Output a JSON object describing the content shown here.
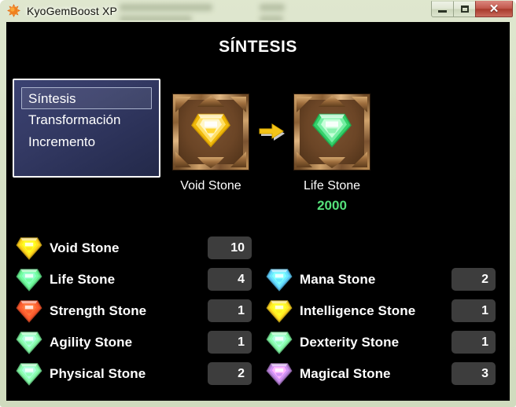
{
  "window": {
    "app_title": "KyoGemBoost XP",
    "app_icon": "sun-icon",
    "controls": {
      "minimize_label": "—",
      "maximize_label": "□",
      "close_label": "✕"
    }
  },
  "page": {
    "title": "SÍNTESIS"
  },
  "mode_list": {
    "selected": "Síntesis",
    "items": [
      {
        "label": "Síntesis",
        "selected": true
      },
      {
        "label": "Transformación",
        "selected": false
      },
      {
        "label": "Incremento",
        "selected": false
      }
    ]
  },
  "preview": {
    "source": {
      "caption": "Void Stone",
      "gem_color": "#f5c518",
      "gem_icon": "void-stone-gem"
    },
    "arrow_icon": "right-arrow-icon",
    "target": {
      "caption": "Life Stone",
      "gem_color": "#63e88c",
      "gem_icon": "life-stone-gem"
    },
    "result_value": "2000",
    "result_color": "#55e07a"
  },
  "inventory": {
    "left": [
      {
        "name": "Void Stone",
        "value": "10",
        "color": "#f5c518",
        "icon": "void-stone-gem"
      },
      {
        "name": "Life Stone",
        "value": "4",
        "color": "#63e88c",
        "icon": "life-stone-gem"
      },
      {
        "name": "Strength Stone",
        "value": "1",
        "color": "#f2542a",
        "icon": "strength-stone-gem"
      },
      {
        "name": "Agility Stone",
        "value": "1",
        "color": "#7bef9d",
        "icon": "agility-stone-gem"
      },
      {
        "name": "Physical Stone",
        "value": "2",
        "color": "#7bef9d",
        "icon": "physical-stone-gem"
      }
    ],
    "right": [
      {
        "name": "Mana Stone",
        "value": "2",
        "color": "#5bc8f5",
        "icon": "mana-stone-gem"
      },
      {
        "name": "Intelligence Stone",
        "value": "1",
        "color": "#f7cf1e",
        "icon": "intelligence-stone-gem"
      },
      {
        "name": "Dexterity Stone",
        "value": "1",
        "color": "#7bef9d",
        "icon": "dexterity-stone-gem"
      },
      {
        "name": "Magical Stone",
        "value": "3",
        "color": "#b57fd4",
        "icon": "magical-stone-gem"
      }
    ]
  }
}
